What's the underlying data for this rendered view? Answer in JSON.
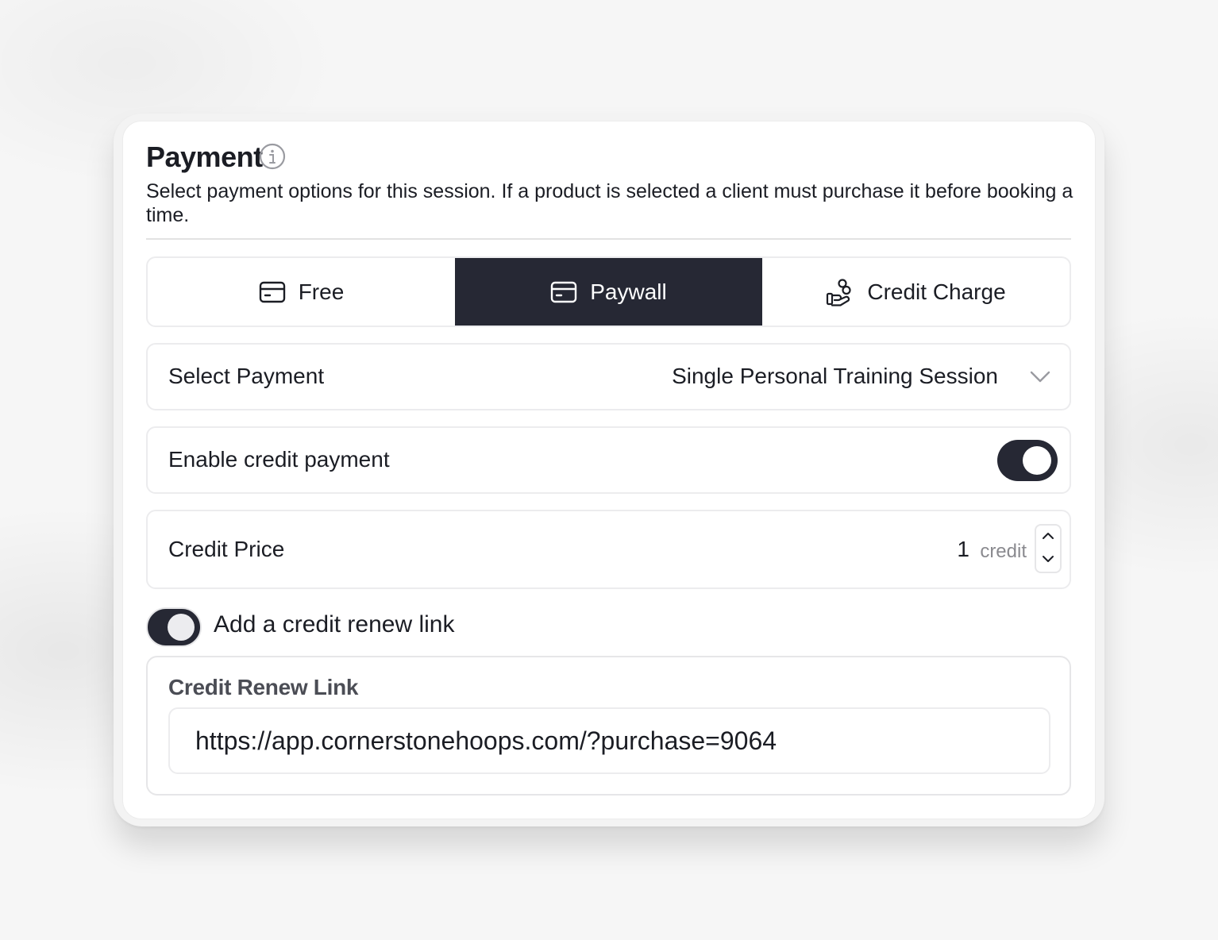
{
  "payment": {
    "title": "Payment",
    "description": "Select payment options for this session. If a product is selected a client must purchase it before booking a time.",
    "info_icon": "info-circle-icon"
  },
  "payment_types": [
    {
      "label": "Free",
      "icon": "card-icon",
      "selected": false
    },
    {
      "label": "Paywall",
      "icon": "card-icon",
      "selected": true
    },
    {
      "label": "Credit Charge",
      "icon": "hand-coins-icon",
      "selected": false
    }
  ],
  "select_payment": {
    "label": "Select Payment",
    "value": "Single Personal Training Session",
    "icon": "chevron-down-icon"
  },
  "enable_credit": {
    "label": "Enable credit payment",
    "enabled": true
  },
  "credit_price": {
    "label": "Credit Price",
    "value": "1",
    "unit": "credit"
  },
  "renew_toggle": {
    "label": "Add a credit renew link",
    "enabled": true
  },
  "renew_link": {
    "title": "Credit Renew Link",
    "value": "https://app.cornerstonehoops.com/?purchase=9064"
  },
  "colors": {
    "accent": "#262834",
    "border": "#ececee",
    "muted_text": "#8a8a8f"
  }
}
